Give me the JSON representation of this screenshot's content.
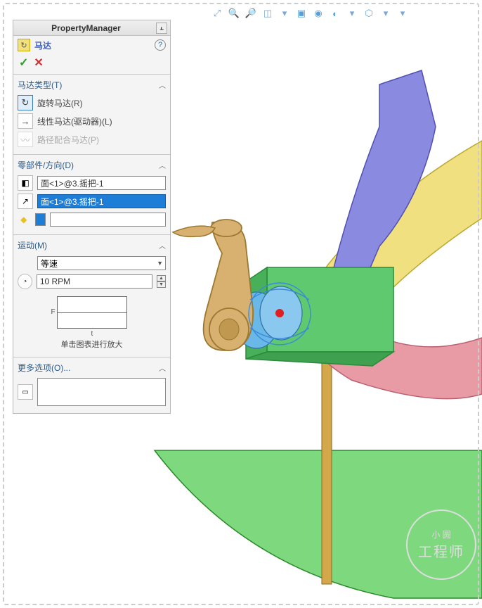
{
  "pm": {
    "title": "PropertyManager"
  },
  "feature": {
    "name": "马达"
  },
  "sections": {
    "type": {
      "title": "马达类型(T)",
      "rotary": "旋转马达(R)",
      "linear": "线性马达(驱动器)(L)",
      "path": "路径配合马达(P)"
    },
    "component": {
      "title": "零部件/方向(D)",
      "field1": "面<1>@3.摇把-1",
      "field2": "面<1>@3.摇把-1"
    },
    "motion": {
      "title": "运动(M)",
      "speed_type": "等速",
      "speed_value": "10 RPM",
      "graph_caption": "单击图表进行放大",
      "f": "F",
      "t": "t"
    },
    "more": {
      "title": "更多选项(O)..."
    }
  },
  "watermark": {
    "line1": "小 圆",
    "line2": "工程师"
  }
}
